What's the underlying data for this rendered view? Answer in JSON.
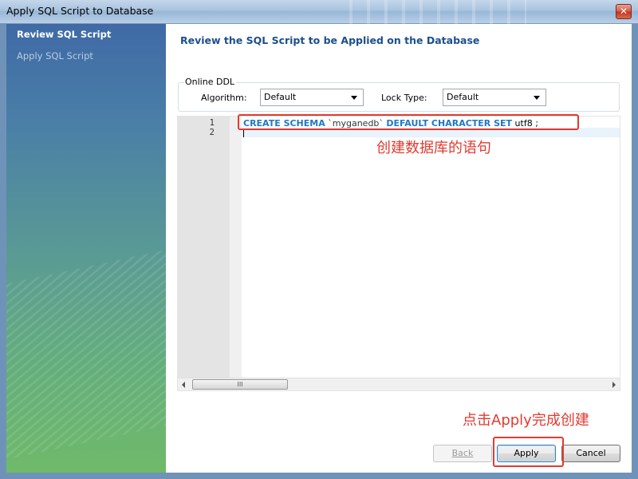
{
  "window": {
    "title": "Apply SQL Script to Database",
    "close_glyph": "✕"
  },
  "sidebar": {
    "steps": [
      {
        "label": "Review SQL Script",
        "active": true
      },
      {
        "label": "Apply SQL Script",
        "active": false
      }
    ]
  },
  "main": {
    "heading": "Review the SQL Script to be Applied on the Database",
    "online_ddl": {
      "legend": "Online DDL",
      "algorithm_label": "Algorithm:",
      "algorithm_value": "Default",
      "lock_type_label": "Lock Type:",
      "lock_type_value": "Default"
    },
    "editor": {
      "line_numbers": [
        "1",
        "2"
      ],
      "code": {
        "kw1": "CREATE SCHEMA",
        "schema_name": "`myganedb`",
        "kw2": "DEFAULT CHARACTER SET",
        "charset": "utf8",
        "terminator": ";"
      },
      "scroll_thumb_grip": "III"
    },
    "buttons": {
      "back": "Back",
      "apply": "Apply",
      "cancel": "Cancel"
    }
  },
  "annotations": {
    "create_db_note": "创建数据库的语句",
    "apply_note": "点击Apply完成创建",
    "highlight_color": "#e23b30"
  },
  "colors": {
    "heading": "#1b4f8e",
    "keyword": "#1e78c4"
  }
}
